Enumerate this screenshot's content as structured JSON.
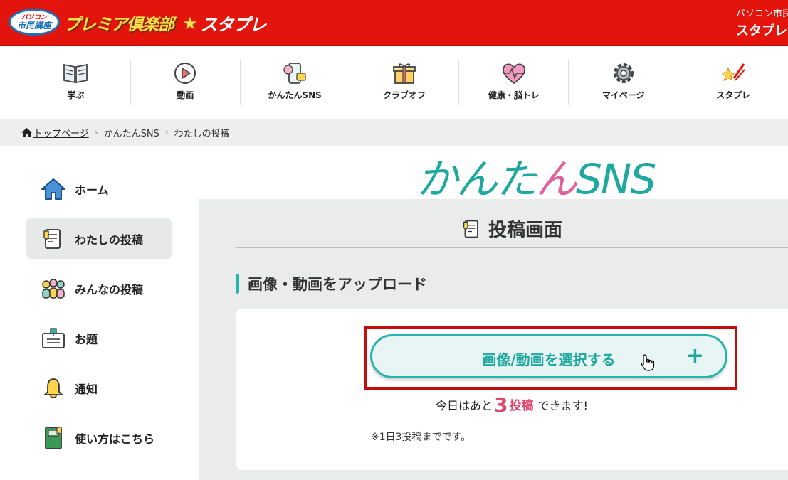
{
  "header": {
    "logo_small_top": "パソコン",
    "logo_small_bottom": "市民講座",
    "logo_main": "プレミア倶楽部",
    "logo_sub": "スタプレ",
    "user_line1": "パソコン市民",
    "user_line2": "スタプレ"
  },
  "nav": [
    {
      "label": "学ぶ",
      "icon": "book-icon"
    },
    {
      "label": "動画",
      "icon": "play-icon"
    },
    {
      "label": "かんたんSNS",
      "icon": "phone-sns-icon"
    },
    {
      "label": "クラブオフ",
      "icon": "gift-icon"
    },
    {
      "label": "健康・脳トレ",
      "icon": "heart-pulse-icon"
    },
    {
      "label": "マイページ",
      "icon": "gear-icon"
    },
    {
      "label": "スタプレ",
      "icon": "star-icon"
    }
  ],
  "breadcrumb": {
    "home": "トップページ",
    "level1": "かんたんSNS",
    "current": "わたしの投稿"
  },
  "sidebar": [
    {
      "label": "ホーム",
      "icon": "home-icon",
      "active": false
    },
    {
      "label": "わたしの投稿",
      "icon": "note-pencil-icon",
      "active": true
    },
    {
      "label": "みんなの投稿",
      "icon": "group-icon",
      "active": false
    },
    {
      "label": "お題",
      "icon": "board-pin-icon",
      "active": false
    },
    {
      "label": "通知",
      "icon": "bell-icon",
      "active": false
    },
    {
      "label": "使い方はこちら",
      "icon": "guide-book-icon",
      "active": false
    }
  ],
  "main": {
    "sns_logo_a": "かんた",
    "sns_logo_b": "ん",
    "sns_logo_c": "SNS",
    "page_title": "投稿画面",
    "section_title": "画像・動画をアップロード",
    "select_button": "画像/動画を選択する",
    "plus_symbol": "+",
    "remain_prefix": "今日はあと",
    "remain_count": "3",
    "remain_unit": "投稿",
    "remain_suffix": "できます!",
    "note": "※1日3投稿までです。"
  },
  "colors": {
    "header_red": "#e3140c",
    "teal": "#25b5ad",
    "pink": "#e0466e",
    "highlight_red": "#c40d0d"
  }
}
